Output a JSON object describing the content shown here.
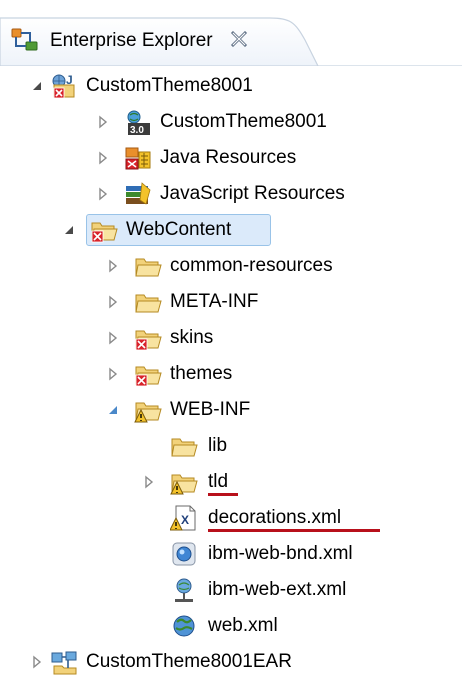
{
  "view": {
    "title": "Enterprise Explorer",
    "close_glyph": "✕"
  },
  "tree": {
    "items": [
      {
        "label": "CustomTheme8001",
        "expanded": true,
        "icon": "web-project-error-icon"
      },
      {
        "label": "CustomTheme8001",
        "expanded": false,
        "icon": "deployment-descriptor-icon"
      },
      {
        "label": "Java Resources",
        "expanded": false,
        "icon": "java-resources-icon"
      },
      {
        "label": "JavaScript Resources",
        "expanded": false,
        "icon": "javascript-resources-icon"
      },
      {
        "label": "WebContent",
        "expanded": true,
        "selected": true,
        "icon": "folder-error-icon"
      },
      {
        "label": "common-resources",
        "expanded": false,
        "icon": "folder-icon"
      },
      {
        "label": "META-INF",
        "expanded": false,
        "icon": "folder-icon"
      },
      {
        "label": "skins",
        "expanded": false,
        "icon": "folder-error-icon"
      },
      {
        "label": "themes",
        "expanded": false,
        "icon": "folder-error-icon"
      },
      {
        "label": "WEB-INF",
        "expanded": true,
        "icon": "folder-warning-icon"
      },
      {
        "label": "lib",
        "icon": "folder-icon"
      },
      {
        "label": "tld",
        "expanded": false,
        "icon": "folder-warning-icon",
        "underlined": true
      },
      {
        "label": "decorations.xml",
        "icon": "xml-warning-icon",
        "underlined": true
      },
      {
        "label": "ibm-web-bnd.xml",
        "icon": "bnd-xml-icon"
      },
      {
        "label": "ibm-web-ext.xml",
        "icon": "ext-xml-icon"
      },
      {
        "label": "web.xml",
        "icon": "web-xml-icon"
      },
      {
        "label": "CustomTheme8001EAR",
        "expanded": false,
        "icon": "ear-project-icon"
      }
    ]
  },
  "colors": {
    "selection_bg": "#dbeafa",
    "selection_border": "#99c3e8",
    "annotation_underline": "#b8101b",
    "folder_fill": "#f2d27a",
    "error_red": "#d8232a",
    "warning_yellow": "#f3c22b"
  }
}
